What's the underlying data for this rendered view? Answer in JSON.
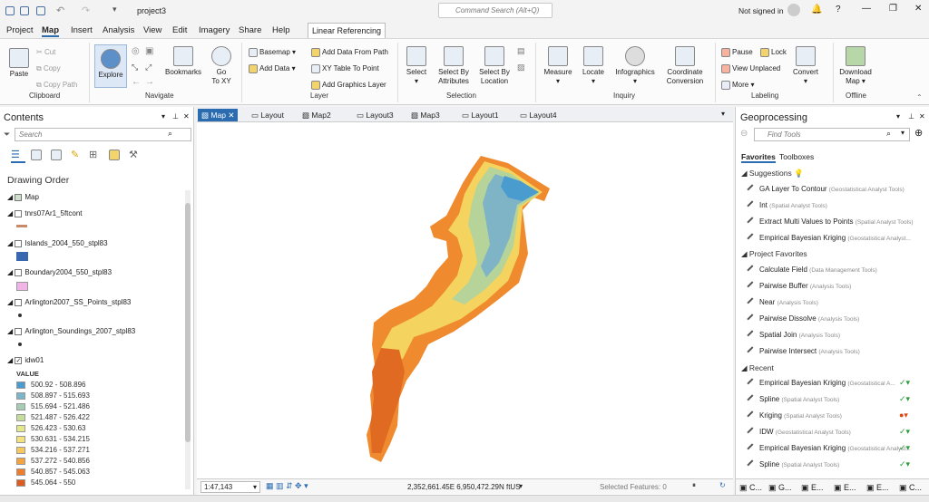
{
  "titlebar": {
    "project": "project3",
    "command_search": "Command Search (Alt+Q)",
    "signin": "Not signed in"
  },
  "menu": [
    "Project",
    "Map",
    "Insert",
    "Analysis",
    "View",
    "Edit",
    "Imagery",
    "Share",
    "Help"
  ],
  "context_tab": "Linear Referencing",
  "ribbon": {
    "clipboard": {
      "paste": "Paste",
      "cut": "Cut",
      "copy": "Copy",
      "copy_path": "Copy Path",
      "group": "Clipboard"
    },
    "navigate": {
      "explore": "Explore",
      "bookmarks": "Bookmarks",
      "goto1": "Go",
      "goto2": "To XY",
      "group": "Navigate"
    },
    "layer": {
      "basemap": "Basemap",
      "add_data": "Add Data",
      "add_from_path": "Add Data From Path",
      "xy_table": "XY Table To Point",
      "add_graphics": "Add Graphics Layer",
      "group": "Layer"
    },
    "selection": {
      "select": "Select",
      "by_attr1": "Select By",
      "by_attr2": "Attributes",
      "by_loc1": "Select By",
      "by_loc2": "Location",
      "group": "Selection"
    },
    "inquiry": {
      "measure": "Measure",
      "locate": "Locate",
      "infographics": "Infographics",
      "coord1": "Coordinate",
      "coord2": "Conversion",
      "group": "Inquiry"
    },
    "labeling": {
      "pause": "Pause",
      "lock": "Lock",
      "view_unplaced": "View Unplaced",
      "more": "More",
      "convert": "Convert",
      "group": "Labeling"
    },
    "offline": {
      "download1": "Download",
      "download2": "Map",
      "group": "Offline"
    }
  },
  "contents": {
    "title": "Contents",
    "search": "Search",
    "drawing_order": "Drawing Order",
    "map": "Map",
    "layers": [
      "tnrs07Ar1_5ftcont",
      "Islands_2004_550_stpl83",
      "Boundary2004_550_stpl83",
      "Arlington2007_SS_Points_stpl83",
      "Arlington_Soundings_2007_stpl83",
      "idw01"
    ],
    "value_label": "VALUE",
    "legend": [
      {
        "label": "500.92 - 508.896",
        "color": "#4a9ccf"
      },
      {
        "label": "508.897 - 515.693",
        "color": "#7ab5c9"
      },
      {
        "label": "515.694 - 521.486",
        "color": "#a6ccb3"
      },
      {
        "label": "521.487 - 526.422",
        "color": "#c5dc9a"
      },
      {
        "label": "526.423 - 530.63",
        "color": "#e3e889"
      },
      {
        "label": "530.631 - 534.215",
        "color": "#f4e27a"
      },
      {
        "label": "534.216 - 537.271",
        "color": "#f7c85a"
      },
      {
        "label": "537.272 - 540.856",
        "color": "#f5a33c"
      },
      {
        "label": "540.857 - 545.063",
        "color": "#ef7d2a"
      },
      {
        "label": "545.064 - 550",
        "color": "#e05a1e"
      }
    ]
  },
  "tabs": [
    "Map",
    "Layout",
    "Map2",
    "Layout3",
    "Map3",
    "Layout1",
    "Layout4"
  ],
  "status": {
    "scale": "1:47,143",
    "coords": "2,352,661.45E 6,950,472.29N ftUS",
    "selected": "Selected Features: 0"
  },
  "geo": {
    "title": "Geoprocessing",
    "find": "Find Tools",
    "tab_fav": "Favorites",
    "tab_tb": "Toolboxes",
    "suggestions": "Suggestions",
    "project_favorites": "Project Favorites",
    "recent": "Recent",
    "sugg": [
      [
        "GA Layer To Contour",
        "(Geostatistical Analyst Tools)"
      ],
      [
        "Int",
        "(Spatial Analyst Tools)"
      ],
      [
        "Extract Multi Values to Points",
        "(Spatial Analyst Tools)"
      ],
      [
        "Empirical Bayesian Kriging",
        "(Geostatistical Analyst..."
      ]
    ],
    "favs": [
      [
        "Calculate Field",
        "(Data Management Tools)"
      ],
      [
        "Pairwise Buffer",
        "(Analysis Tools)"
      ],
      [
        "Near",
        "(Analysis Tools)"
      ],
      [
        "Pairwise Dissolve",
        "(Analysis Tools)"
      ],
      [
        "Spatial Join",
        "(Analysis Tools)"
      ],
      [
        "Pairwise Intersect",
        "(Analysis Tools)"
      ]
    ],
    "recent_items": [
      [
        "Empirical Bayesian Kriging",
        "(Geostatistical A..."
      ],
      [
        "Spline",
        "(Spatial Analyst Tools)"
      ],
      [
        "Kriging",
        "(Spatial Analyst Tools)"
      ],
      [
        "IDW",
        "(Geostatistical Analyst Tools)"
      ],
      [
        "Empirical Bayesian Kriging",
        "(Geostatistical Analyst..."
      ],
      [
        "Spline",
        "(Spatial Analyst Tools)"
      ]
    ]
  }
}
